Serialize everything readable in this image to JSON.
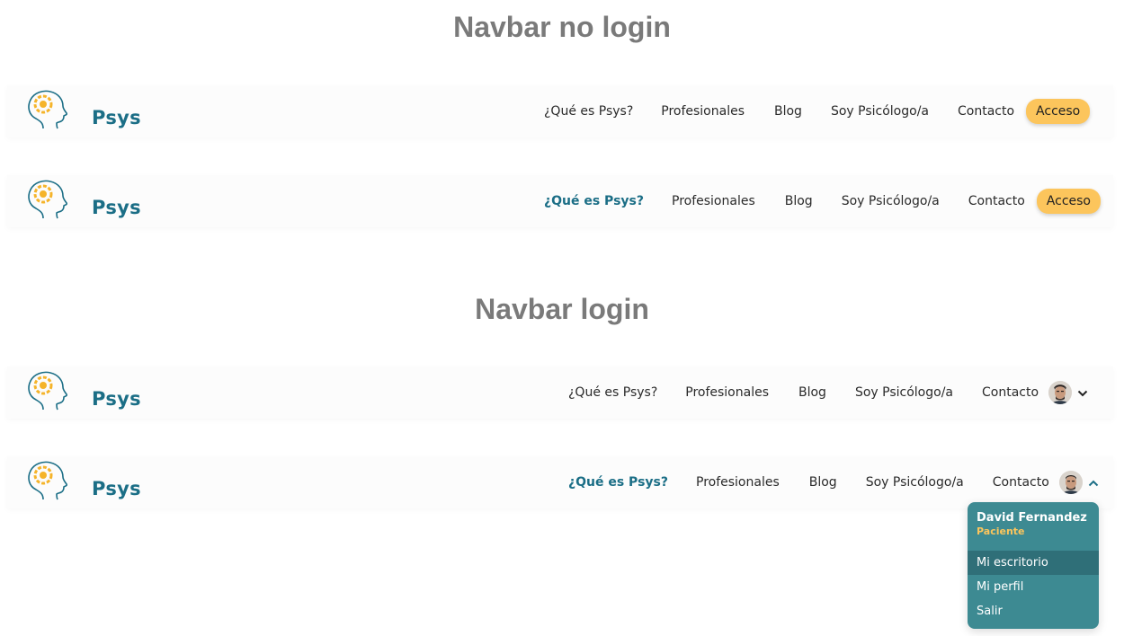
{
  "sections": {
    "no_login_title": "Navbar no login",
    "login_title": "Navbar login"
  },
  "brand": {
    "name": "Psys"
  },
  "nav": {
    "items": [
      "¿Qué es Psys?",
      "Profesionales",
      "Blog",
      "Soy Psicólogo/a",
      "Contacto"
    ],
    "acceso": "Acceso"
  },
  "colors": {
    "brand": "#1b6e86",
    "accent": "#fcc55c",
    "menu_bg": "#3d8a92",
    "title_gray": "#7a7a7a"
  },
  "user_menu": {
    "name": "David Fernandez",
    "role": "Paciente",
    "items": [
      "Mi escritorio",
      "Mi perfil",
      "Salir"
    ]
  },
  "icons": {
    "logo": "head-with-sunflower-icon",
    "chevron_down": "chevron-down-icon",
    "chevron_up": "chevron-up-icon",
    "avatar": "user-avatar"
  }
}
